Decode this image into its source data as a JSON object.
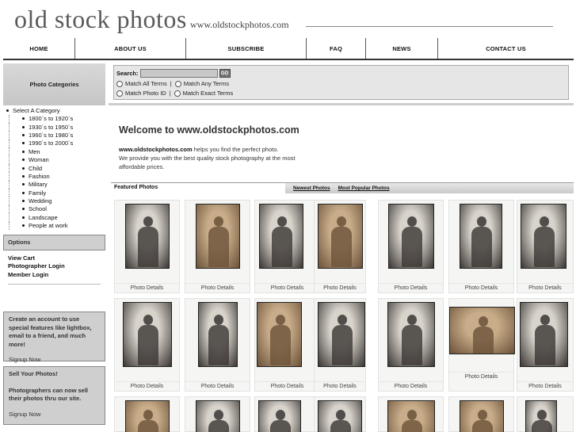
{
  "header": {
    "logo_text": "old stock photos",
    "domain_text": "www.oldstockphotos.com"
  },
  "nav": {
    "items": [
      {
        "label": "HOME"
      },
      {
        "label": "ABOUT US"
      },
      {
        "label": "SUBSCRIBE"
      },
      {
        "label": "FAQ"
      },
      {
        "label": "NEWS"
      },
      {
        "label": "CONTACT US"
      }
    ]
  },
  "sidebar": {
    "categories_heading": "Photo Categories",
    "root_label": "Select A Category",
    "categories": [
      "1800`s to 1920`s",
      "1930`s to 1950`s",
      "1960`s to 1980`s",
      "1990`s to 2000`s",
      "Men",
      "Woman",
      "Child",
      "Fashion",
      "Military",
      "Family",
      "Wedding",
      "School",
      "Landscape",
      "People at work"
    ],
    "options_heading": "Options",
    "option_links": [
      "View Cart",
      "Photographer Login",
      "Member Login"
    ],
    "promo1": {
      "text": "Create an account to use special features like lightbox, email to a friend, and much more!",
      "link": "Signup Now"
    },
    "promo2": {
      "title": "Sell Your Photos!",
      "text": "Photographers can now sell their photos thru our site.",
      "link": "Signup Now"
    }
  },
  "search": {
    "label": "Search:",
    "value": "",
    "go_label": "GO",
    "options": [
      {
        "label": "Match All Terms"
      },
      {
        "label": "Match Any Terms"
      },
      {
        "label": "Match Photo ID"
      },
      {
        "label": "Match Exact Terms"
      }
    ],
    "separator": "|"
  },
  "welcome": {
    "title": "Welcome to www.oldstockphotos.com",
    "site_name": "www.oldstockphotos.com",
    "line1_rest": " helps you find the perfect photo.",
    "line2": "We provide you with the best quality stock photography at the most affordable prices."
  },
  "featured": {
    "title": "Featured Photos",
    "tabs": [
      "Newest Photos",
      "Most Popular Photos"
    ],
    "details_label": "Photo Details"
  },
  "colors": {
    "sepia_light": "#c9ad8a",
    "sepia_dark": "#6b5238",
    "bw_light": "#d8d4cc",
    "bw_dark": "#3a3532"
  }
}
